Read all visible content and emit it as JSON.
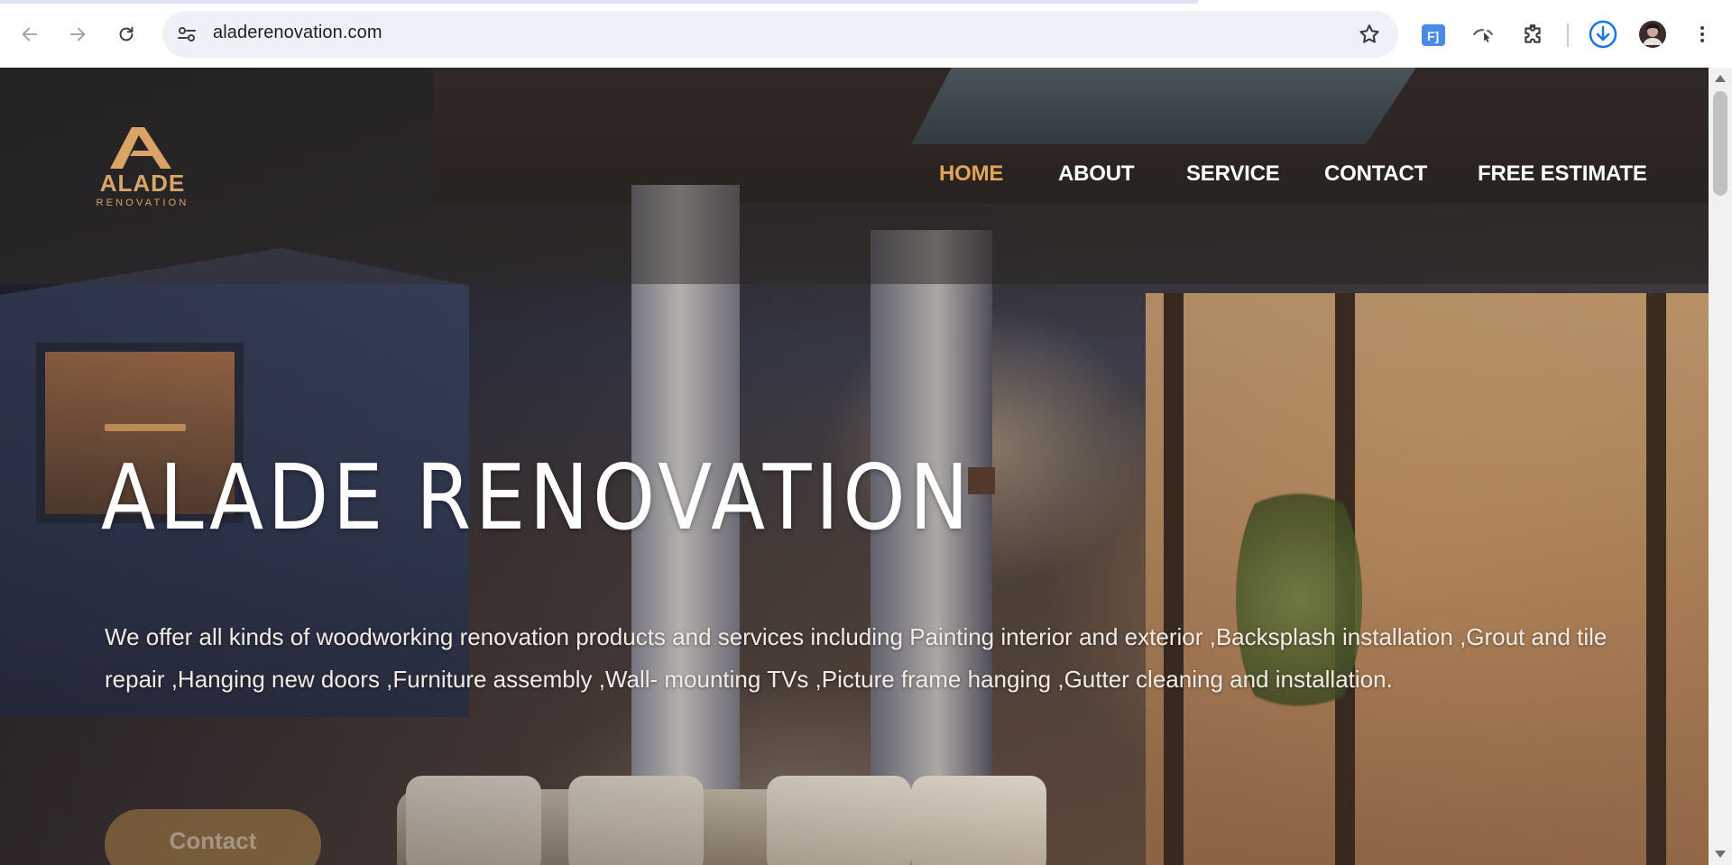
{
  "browser": {
    "url": "aladerenovation.com",
    "icons": {
      "back": "arrow-left-icon",
      "forward": "arrow-right-icon",
      "reload": "reload-icon",
      "site_info": "tune-icon",
      "bookmark": "star-icon",
      "ext_1": "fi-extension-icon",
      "ext_2": "cursor-extension-icon",
      "extensions": "puzzle-icon",
      "download": "download-icon",
      "profile": "avatar",
      "menu": "kebab-menu-icon"
    },
    "ext_1_label": "F]"
  },
  "site": {
    "logo": {
      "brand": "ALADE",
      "sub": "RENOVATION"
    },
    "nav": [
      {
        "label": "HOME",
        "active": true
      },
      {
        "label": "ABOUT",
        "active": false
      },
      {
        "label": "SERVICE",
        "active": false
      },
      {
        "label": "CONTACT",
        "active": false
      },
      {
        "label": "FREE ESTIMATE",
        "active": false
      }
    ],
    "hero": {
      "title": "ALADE RENOVATION",
      "description": "We offer all kinds of woodworking renovation products and services including Painting interior and exterior ,Backsplash installation ,Grout and tile repair ,Hanging new doors ,Furniture assembly ,Wall- mounting TVs ,Picture frame hanging ,Gutter cleaning and installation.",
      "button": "Contact"
    },
    "colors": {
      "accent": "#e0a558",
      "logo": "#d9a566",
      "text": "#ffffff"
    }
  }
}
